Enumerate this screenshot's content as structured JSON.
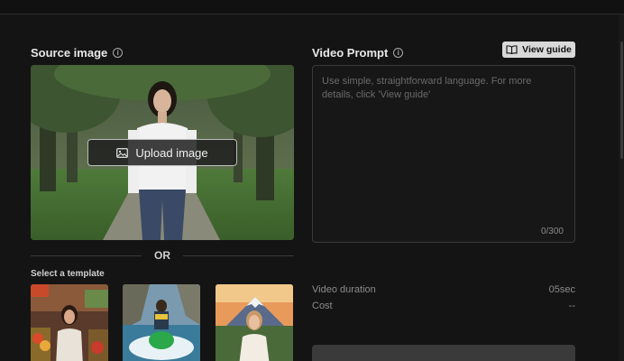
{
  "source": {
    "label": "Source image",
    "upload_label": "Upload image",
    "or_label": "OR",
    "template_label": "Select a template"
  },
  "prompt": {
    "label": "Video Prompt",
    "view_guide_label": "View guide",
    "placeholder": "Use simple, straightforward language. For more details, click 'View guide'",
    "counter": "0/300"
  },
  "settings": {
    "duration_label": "Video duration",
    "duration_value": "05sec",
    "cost_label": "Cost",
    "cost_value": "--"
  },
  "icons": {
    "info": "info-icon",
    "upload": "image-icon",
    "guide": "book-icon"
  },
  "colors": {
    "background": "#141414",
    "panel_border": "#3a3a3a",
    "view_guide_bg": "#d9d9d9"
  }
}
